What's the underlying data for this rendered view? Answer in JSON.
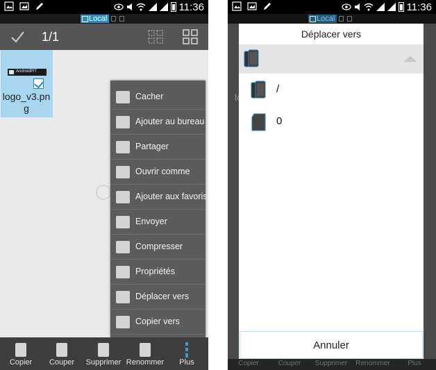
{
  "status_bar": {
    "time": "11:36",
    "location_chip": "Local"
  },
  "toolbar": {
    "selection_count": "1/1"
  },
  "file": {
    "name": "logo_v3.png",
    "thumbnail_text": "AndroidPIT",
    "checked": true
  },
  "context_menu": {
    "items": [
      {
        "label": "Cacher",
        "icon": "hide-folder-icon"
      },
      {
        "label": "Ajouter au bureau",
        "icon": "add-to-desktop-icon"
      },
      {
        "label": "Partager",
        "icon": "share-icon"
      },
      {
        "label": "Ouvrir comme",
        "icon": "open-folder-icon"
      },
      {
        "label": "Ajouter aux favoris",
        "icon": "favorite-star-icon"
      },
      {
        "label": "Envoyer",
        "icon": "send-icon"
      },
      {
        "label": "Compresser",
        "icon": "compress-icon"
      },
      {
        "label": "Propriétés",
        "icon": "info-icon"
      },
      {
        "label": "Déplacer vers",
        "icon": "move-to-icon"
      },
      {
        "label": "Copier vers",
        "icon": "copy-to-icon"
      }
    ]
  },
  "bottom_bar": {
    "items": [
      {
        "label": "Copier",
        "icon": "copy-icon"
      },
      {
        "label": "Couper",
        "icon": "scissors-icon"
      },
      {
        "label": "Supprimer",
        "icon": "trash-icon"
      },
      {
        "label": "Renommer",
        "icon": "rename-icon"
      },
      {
        "label": "Plus",
        "icon": "more-dots-icon"
      }
    ]
  },
  "move_dialog": {
    "title": "Déplacer vers",
    "entries": [
      {
        "label": "/",
        "icon": "phone-storage-icon"
      },
      {
        "label": "0",
        "icon": "sd-card-icon"
      }
    ],
    "cancel_label": "Annuler",
    "background_name_fragment": "lo"
  },
  "colors": {
    "accent": "#3a9ad9",
    "selection": "#a8d6ee",
    "menu_bg": "#5c5c5c"
  }
}
